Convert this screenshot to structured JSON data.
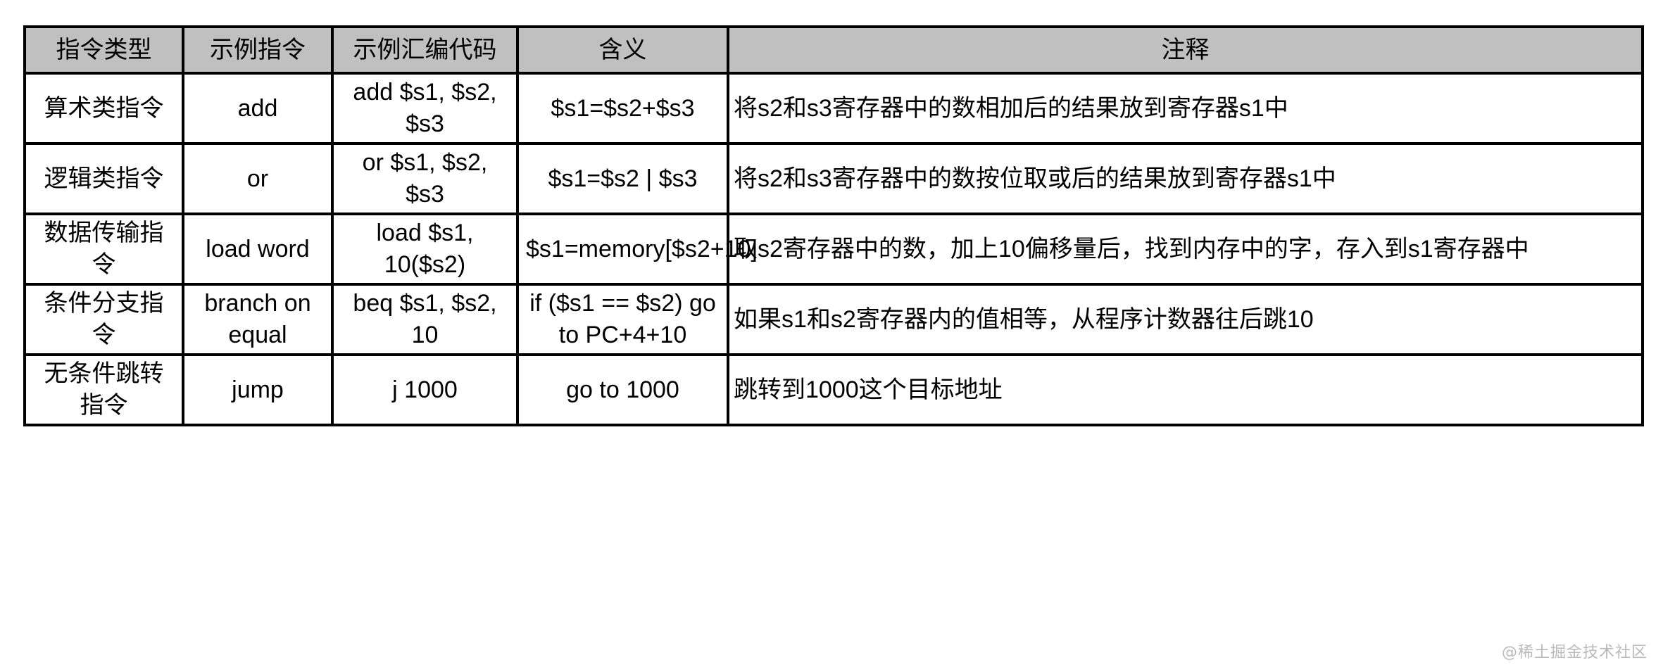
{
  "table": {
    "headers": [
      "指令类型",
      "示例指令",
      "示例汇编代码",
      "含义",
      "注释"
    ],
    "rows": [
      {
        "type": "算术类指令",
        "example": "add",
        "asm": "add $s1, $s2, $s3",
        "meaning": "$s1=$s2+$s3",
        "note": "将s2和s3寄存器中的数相加后的结果放到寄存器s1中"
      },
      {
        "type": "逻辑类指令",
        "example": "or",
        "asm": "or $s1, $s2, $s3",
        "meaning": "$s1=$s2 | $s3",
        "note": "将s2和s3寄存器中的数按位取或后的结果放到寄存器s1中"
      },
      {
        "type": "数据传输指令",
        "example": "load word",
        "asm": "load $s1, 10($s2)",
        "meaning": "$s1=memory[$s2+10]",
        "note": "取s2寄存器中的数，加上10偏移量后，找到内存中的字，存入到s1寄存器中"
      },
      {
        "type": "条件分支指令",
        "example": "branch on equal",
        "asm": "beq $s1, $s2, 10",
        "meaning": "if ($s1 == $s2) go to PC+4+10",
        "note": "如果s1和s2寄存器内的值相等，从程序计数器往后跳10"
      },
      {
        "type": "无条件跳转指令",
        "example": "jump",
        "asm": "j 1000",
        "meaning": "go to 1000",
        "note": "跳转到1000这个目标地址"
      }
    ]
  },
  "watermark": {
    "text": "@稀土掘金技术社区"
  },
  "colors": {
    "header_background": "#c0c0c0",
    "cell_background": "#ffffff",
    "border": "#000000",
    "text": "#000000",
    "watermark": "#b9b9b9"
  }
}
